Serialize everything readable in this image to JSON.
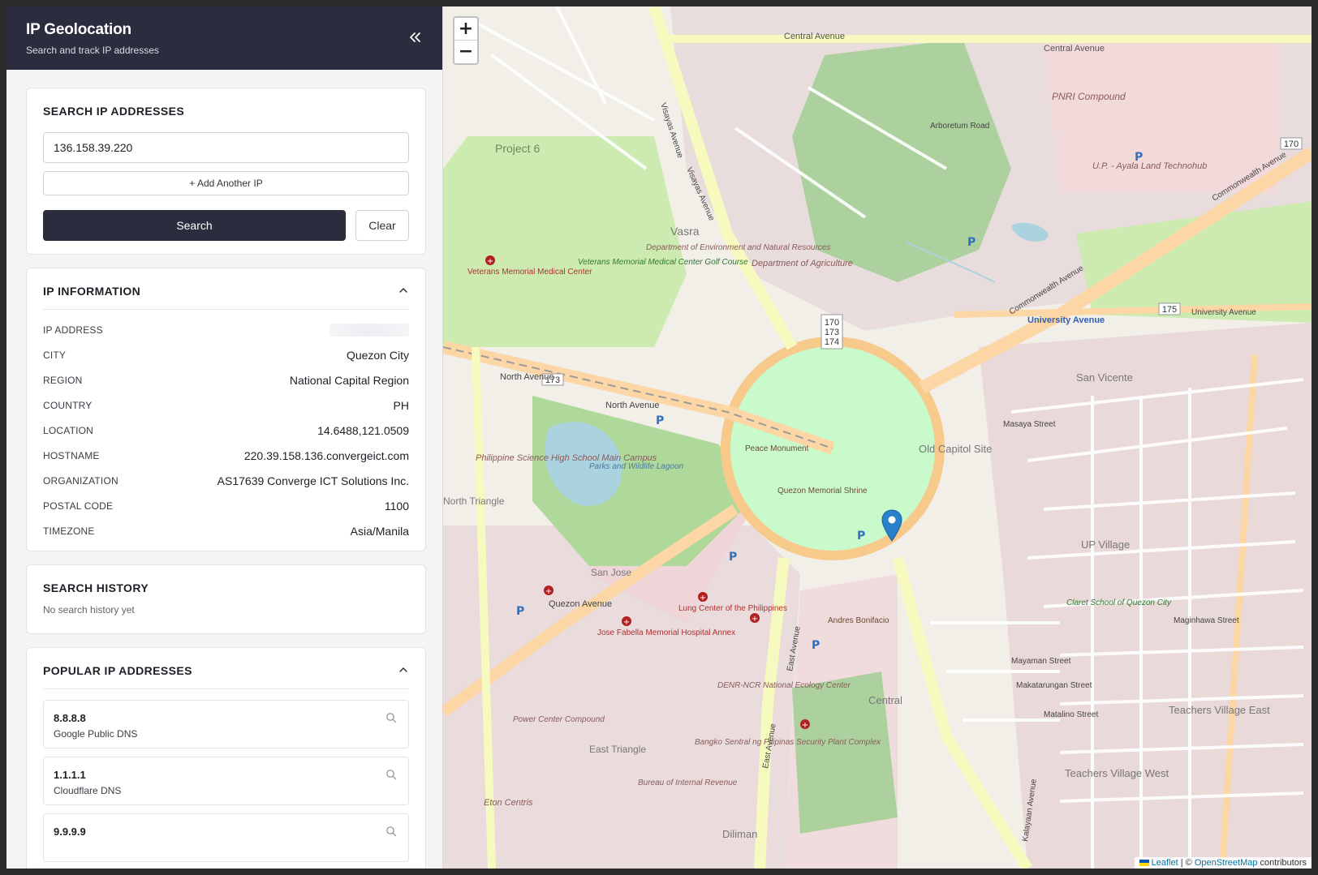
{
  "header": {
    "title": "IP Geolocation",
    "subtitle": "Search and track IP addresses",
    "collapse_icon": "double-chevron-left-icon"
  },
  "search": {
    "heading": "SEARCH IP ADDRESSES",
    "ip_value": "136.158.39.220",
    "add_label": "+ Add Another IP",
    "search_label": "Search",
    "clear_label": "Clear"
  },
  "info": {
    "heading": "IP INFORMATION",
    "rows": [
      {
        "label": "IP ADDRESS",
        "value": ""
      },
      {
        "label": "CITY",
        "value": "Quezon City"
      },
      {
        "label": "REGION",
        "value": "National Capital Region"
      },
      {
        "label": "COUNTRY",
        "value": "PH"
      },
      {
        "label": "LOCATION",
        "value": "14.6488,121.0509"
      },
      {
        "label": "HOSTNAME",
        "value": "220.39.158.136.convergeict.com"
      },
      {
        "label": "ORGANIZATION",
        "value": "AS17639 Converge ICT Solutions Inc."
      },
      {
        "label": "POSTAL CODE",
        "value": "1100"
      },
      {
        "label": "TIMEZONE",
        "value": "Asia/Manila"
      }
    ]
  },
  "history": {
    "heading": "SEARCH HISTORY",
    "empty": "No search history yet"
  },
  "popular": {
    "heading": "POPULAR IP ADDRESSES",
    "items": [
      {
        "ip": "8.8.8.8",
        "name": "Google Public DNS"
      },
      {
        "ip": "1.1.1.1",
        "name": "Cloudflare DNS"
      },
      {
        "ip": "9.9.9.9",
        "name": ""
      }
    ]
  },
  "map": {
    "zoom_in": "+",
    "zoom_out": "−",
    "attr_leaflet": "Leaflet",
    "attr_sep": " | © ",
    "attr_osm": "OpenStreetMap",
    "attr_tail": " contributors",
    "labels": {
      "l1": "Central Avenue",
      "l2": "Project 6",
      "l3": "Vasra",
      "l4": "Veterans Memorial Medical Center",
      "l5": "Department of Agriculture",
      "l6": "PNRI Compound",
      "l7": "U.P. - Ayala Land Technohub",
      "l8": "University Avenue",
      "l9": "San Vicente",
      "l10": "Old Capitol Site",
      "l11": "North Avenue",
      "l12": "Philippine Science High School Main Campus",
      "l13": "Parks and Wildlife Lagoon",
      "l14": "Peace Monument",
      "l15": "Quezon Memorial Shrine",
      "l16": "UP Village",
      "l17": "San Jose",
      "l18": "Quezon Avenue",
      "l19": "Lung Center of the Philippines",
      "l20": "Jose Fabella Memorial Hospital Annex",
      "l21": "East Avenue",
      "l22": "Central",
      "l23": "Teachers Village East",
      "l24": "Teachers Village West",
      "l25": "East Triangle",
      "l26": "Eton Centris",
      "l27": "Diliman",
      "l28": "Andres Bonifacio",
      "l29": "Commonwealth Avenue",
      "l30": "Bureau of Internal Revenue",
      "l31": "Power Center Compound",
      "l32": "Veterans Memorial Medical Center Golf Course",
      "l33": "Department of Environment and Natural Resources",
      "l34": "DENR-NCR National Ecology Center",
      "l35": "Bangko Sentral ng Pilipinas Security Plant Complex",
      "l36": "Claret School of Quezon City",
      "l37": "North Triangle",
      "l38": "Visayas Avenue",
      "l39": "Arboretum Road",
      "l40": "Maginhawa Street",
      "l41": "Kalayaan Avenue",
      "l42": "Mayaman Street",
      "l43": "Makatarungan Street",
      "l44": "Matalino Street",
      "l45": "Masaya Street",
      "l46": "170",
      "l47": "173",
      "l48": "174",
      "l49": "175"
    }
  },
  "colors": {
    "header": "#2b2d3e",
    "accent": "#2b2d3e",
    "marker": "#2a81cb",
    "park": "#c8facc",
    "road_major": "#fcd6a4",
    "road_trunk": "#f7fabf"
  }
}
